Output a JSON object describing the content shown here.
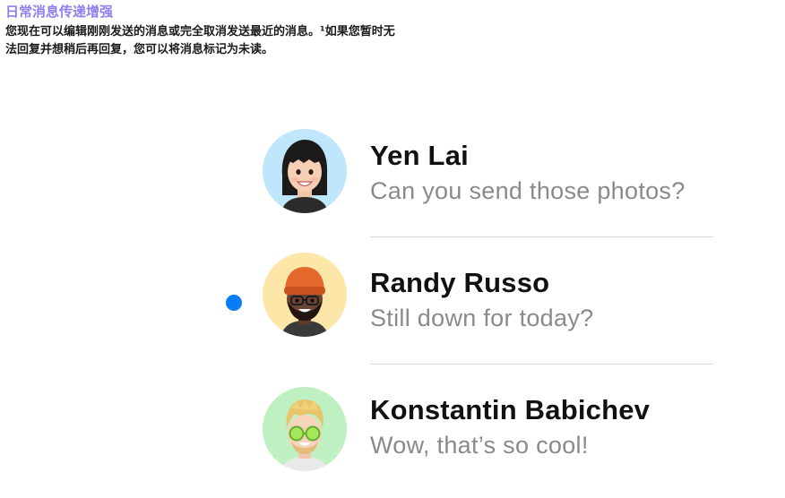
{
  "header": {
    "title": "日常消息传递增强",
    "description_line1": "您现在可以编辑刚刚发送的消息或完全取消发送最近的消息。¹如果您暂时无",
    "description_line2": "法回复并想稍后再回复，您可以将消息标记为未读。"
  },
  "conversations": [
    {
      "name": "Yen Lai",
      "preview": "Can you send those photos?",
      "unread": false,
      "avatar_bg": "#bfe6fb",
      "avatar_icon": "memoji-woman-bangs-icon"
    },
    {
      "name": "Randy Russo",
      "preview": "Still down for today?",
      "unread": true,
      "avatar_bg": "#fde7a8",
      "avatar_icon": "memoji-man-orange-beanie-icon"
    },
    {
      "name": "Konstantin Babichev",
      "preview": "Wow, that’s so cool!",
      "unread": false,
      "avatar_bg": "#bff0c2",
      "avatar_icon": "memoji-man-green-glasses-icon"
    }
  ],
  "colors": {
    "title": "#8f7ff0",
    "unread_dot": "#0a7cf4",
    "preview_text": "#8a8a8e",
    "divider": "#d8d8dc"
  }
}
